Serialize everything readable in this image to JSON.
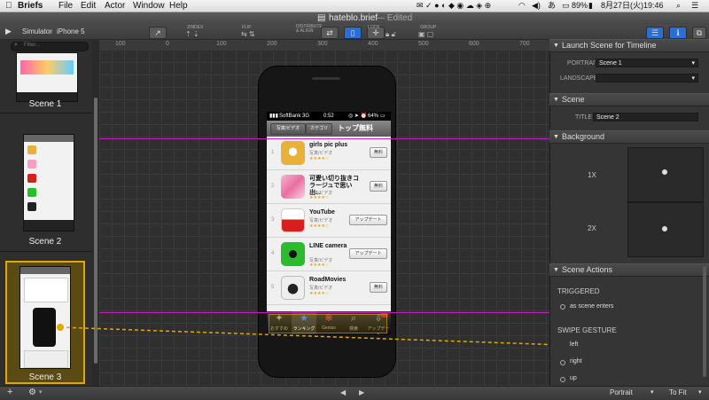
{
  "menubar": {
    "app_name": "Briefs",
    "items": [
      "File",
      "Edit",
      "Actor",
      "Window",
      "Help"
    ],
    "battery": "89%",
    "date": "8月27日(火)",
    "time": "19:46"
  },
  "window": {
    "doc_title": "hateblo.brief",
    "doc_status": "— Edited"
  },
  "toolbar": {
    "simulator_label": "Simulator",
    "device_label": "iPhone 5",
    "groups": [
      "ZINDEX",
      "FLIP",
      "DISTRIBUTE & ALIGN",
      "LOCK",
      "GROUP"
    ]
  },
  "sidebar": {
    "filter_placeholder": "Filter...",
    "scenes": [
      {
        "label": "Scene 1"
      },
      {
        "label": "Scene 2"
      },
      {
        "label": "Scene 3"
      }
    ]
  },
  "ruler": {
    "ticks": [
      "100",
      "0",
      "100",
      "200",
      "300",
      "400",
      "500",
      "600",
      "700"
    ]
  },
  "phone": {
    "status": {
      "carrier": "SoftBank",
      "network": "3G",
      "time": "0:52",
      "battery": "64%"
    },
    "nav": {
      "seg1": "写真/ビデオ",
      "seg2": "カテゴリ",
      "title": "トップ無料"
    },
    "apps": [
      {
        "num": "1",
        "name": "girls pic plus",
        "category": "写真/ビデオ",
        "stars": "★★★★☆",
        "button": "無料"
      },
      {
        "num": "2",
        "name": "可愛い切り抜きコラージュで思い出...",
        "category": "写真/ビデオ",
        "stars": "★★★★☆",
        "button": "無料"
      },
      {
        "num": "3",
        "name": "YouTube",
        "category": "写真/ビデオ",
        "stars": "★★★★☆",
        "button": "アップデート"
      },
      {
        "num": "4",
        "name": "LINE camera",
        "category": "写真/ビデオ",
        "stars": "★★★★☆",
        "button": "アップデート"
      },
      {
        "num": "5",
        "name": "RoadMovies",
        "category": "写真/ビデオ",
        "stars": "★★★★☆",
        "button": "無料"
      }
    ],
    "tabs": [
      {
        "label": "おすすめ"
      },
      {
        "label": "ランキング"
      },
      {
        "label": "Genius"
      },
      {
        "label": "検索"
      },
      {
        "label": "アップデート"
      }
    ]
  },
  "inspector": {
    "launch_section": "Launch Scene for Timeline",
    "portrait_label": "PORTRAIT",
    "portrait_value": "Scene 1",
    "landscape_label": "LANDSCAPE",
    "landscape_value": "",
    "scene_section": "Scene",
    "title_label": "TITLE",
    "title_value": "Scene 2",
    "background_section": "Background",
    "bg_1x": "1X",
    "bg_2x": "2X",
    "actions_section": "Scene Actions",
    "triggered_label": "TRIGGERED",
    "triggered_item": "as scene enters",
    "swipe_label": "SWIPE GESTURE",
    "swipe_items": [
      "left",
      "right",
      "up"
    ]
  },
  "bottombar": {
    "orientation": "Portrait",
    "zoom": "To Fit"
  },
  "colors": {
    "selection": "#e0a800",
    "guide": "#c020c0",
    "accent_blue": "#2a6fd6"
  }
}
